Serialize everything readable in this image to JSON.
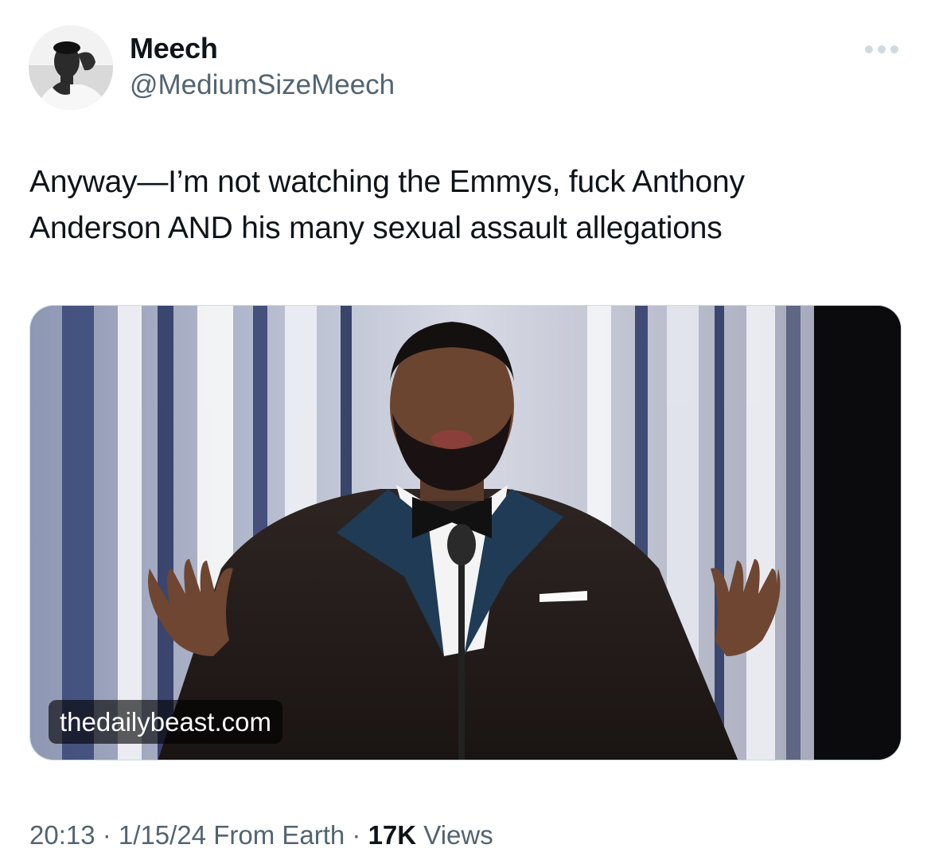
{
  "tweet": {
    "author": {
      "display_name": "Meech",
      "handle": "@MediumSizeMeech",
      "avatar_icon": "profile-photo"
    },
    "more_icon": "more-horizontal-icon",
    "text_line_1": "Anyway—I’m not watching the Emmys, fuck Anthony",
    "text_line_2": "Anderson AND his many sexual assault allegations",
    "media": {
      "source_label": "thedailybeast.com"
    },
    "meta": {
      "time": "20:13",
      "separator_1": " · ",
      "date": "1/15/24",
      "location": " From Earth",
      "separator_2": " · ",
      "views_count": "17K",
      "views_label": " Views"
    }
  },
  "colors": {
    "text_primary": "#0f1419",
    "text_secondary": "#536471",
    "border": "#cfd9de"
  }
}
